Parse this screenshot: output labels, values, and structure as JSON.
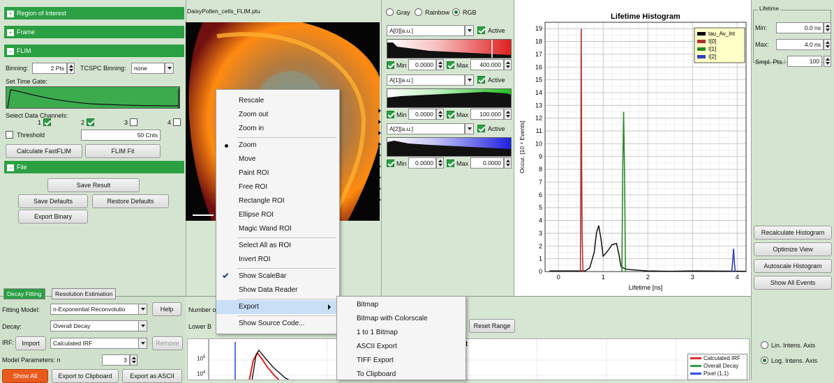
{
  "left_panel": {
    "sections": {
      "roi": "Region of Interest",
      "frame": "Frame",
      "flim": "FLIM",
      "file": "File"
    },
    "binning_label": "Binning:",
    "binning_value": "2 Pts",
    "tcspc_label": "TCSPC Binning:",
    "tcspc_value": "none",
    "time_gate_label": "Set Time Gate:",
    "channels_label": "Select Data Channels:",
    "channels": [
      "1",
      "2",
      "3",
      "4"
    ],
    "threshold_label": "Threshold",
    "threshold_value": "50 Cnts",
    "calc_fastflim": "Calculate FastFLIM",
    "flim_fit": "FLIM Fit",
    "save_result": "Save Result",
    "save_defaults": "Save Defaults",
    "restore_defaults": "Restore Defaults",
    "export_binary": "Export Binary"
  },
  "bottom_left": {
    "tabs": [
      "Decay Fitting",
      "Resolution Estimation"
    ],
    "fitting_model_label": "Fitting Model:",
    "fitting_model_value": "n-Exponential Reconvolutio",
    "help": "Help",
    "decay_label": "Decay:",
    "decay_value": "Overall Decay",
    "irf_label": "IRF:",
    "import": "Import",
    "irf_value": "Calculated IRF",
    "remove": "Remove",
    "model_params_label": "Model Parameters:  n",
    "model_params_value": "3",
    "show_all": "Show All",
    "export_clipboard": "Export to Clipboard",
    "export_ascii": "Export as ASCII"
  },
  "image": {
    "filename": "DaisyPollen_cells_FLIM.ptu"
  },
  "colormap": {
    "options": [
      "Gray",
      "Rainbow",
      "RGB"
    ],
    "selected": "RGB",
    "channels": [
      {
        "name": "A[0][a.u.]",
        "active": "Active",
        "min_label": "Min",
        "min": "0.0000",
        "max_label": "Max",
        "max": "400.000",
        "color": "#e01010"
      },
      {
        "name": "A[1][a.u.]",
        "active": "Active",
        "min_label": "Min",
        "min": "0.0000",
        "max_label": "Max",
        "max": "100.000",
        "color": "#10c010"
      },
      {
        "name": "A[2][a.u.]",
        "active": "Active",
        "min_label": "Min",
        "min": "0.0000",
        "max_label": "Max",
        "max": "0.0000",
        "color": "#1010e0"
      }
    ]
  },
  "context_menu": {
    "items": [
      "Rescale",
      "Zoom out",
      "Zoom in",
      "Zoom",
      "Move",
      "Paint ROI",
      "Free ROI",
      "Rectangle ROI",
      "Ellipse ROI",
      "Magic Wand ROI",
      "Select All as ROI",
      "Invert ROI",
      "Show ScaleBar",
      "Show Data Reader",
      "Export",
      "Show Source Code..."
    ],
    "checked": [
      "Zoom",
      "Show ScaleBar"
    ],
    "highlighted": "Export"
  },
  "export_submenu": {
    "items": [
      "Bitmap",
      "Bitmap with Colorscale",
      "1 to 1 Bitmap",
      "ASCII Export",
      "TIFF Export",
      "To Clipboard"
    ]
  },
  "middle_bottom": {
    "number_label": "Number o",
    "lower_label": "Lower B",
    "reset_range": "Reset Range",
    "fit_title": "Fit",
    "ytick_1": "10",
    "ytick_1_exp": "5",
    "ytick_2": "10",
    "ytick_2_exp": "4",
    "legend": [
      {
        "name": "Calculated IRF",
        "color": "#e03030"
      },
      {
        "name": "Overall Decay",
        "color": "#2aa043"
      },
      {
        "name": "Pixel (1,1)",
        "color": "#3050e0"
      }
    ]
  },
  "histogram": {
    "chart_data": {
      "type": "line",
      "title": "Lifetime Histogram",
      "xlabel": "Lifetime [ns]",
      "ylabel": "Occur. [10 ⁴ Events]",
      "xlim": [
        -0.3,
        4.2
      ],
      "ylim": [
        0,
        19.5
      ],
      "xticks": [
        0,
        1,
        2,
        3,
        4
      ],
      "yticks": [
        0,
        1,
        2,
        3,
        4,
        5,
        6,
        7,
        8,
        9,
        10,
        11,
        12,
        13,
        14,
        15,
        16,
        17,
        18,
        19
      ],
      "grid": true,
      "legend_position": "top-right",
      "series": [
        {
          "name": "tau_Av_Int",
          "color": "#000000",
          "x": [
            -0.2,
            0.6,
            0.7,
            0.8,
            0.85,
            0.9,
            0.95,
            1.0,
            1.1,
            1.2,
            1.3,
            1.35,
            1.4,
            1.5,
            1.6,
            1.8,
            2.0,
            2.5,
            3.0,
            4.2
          ],
          "y": [
            0.05,
            0.05,
            0.3,
            1.5,
            3.0,
            3.6,
            2.6,
            1.2,
            1.6,
            2.1,
            2.2,
            1.4,
            0.4,
            0.2,
            0.15,
            0.1,
            0.05,
            0.02,
            0.05,
            0.02
          ]
        },
        {
          "name": "I[0]",
          "color": "#b03030",
          "x": [
            0.49,
            0.5,
            0.51,
            0.52,
            0.53,
            0.54,
            0.55
          ],
          "y": [
            0,
            6.5,
            19.0,
            8.0,
            3.0,
            1.0,
            0
          ]
        },
        {
          "name": "I[1]",
          "color": "#2a8a2a",
          "x": [
            1.42,
            1.44,
            1.46,
            1.48,
            1.5
          ],
          "y": [
            0,
            8.5,
            12.5,
            7.5,
            0
          ]
        },
        {
          "name": "I[2]",
          "color": "#3040c0",
          "x": [
            3.88,
            3.9,
            3.92,
            3.94,
            3.96
          ],
          "y": [
            0,
            0.8,
            1.8,
            0.6,
            0
          ]
        }
      ]
    }
  },
  "lifetime_panel": {
    "title": "Lifetime",
    "min_label": "Min:",
    "min_value": "0.0 ns",
    "max_label": "Max:",
    "max_value": "4.0 ns",
    "smpl_label": "Smpl. Pts.:",
    "smpl_value": "100",
    "recalc": "Recalculate Histogram",
    "optimize": "Optimize View",
    "autoscale": "Autoscale Histogram",
    "show_all": "Show All Events",
    "lin_axis": "Lin. Intens. Axis",
    "log_axis": "Log. Intens. Axis"
  }
}
